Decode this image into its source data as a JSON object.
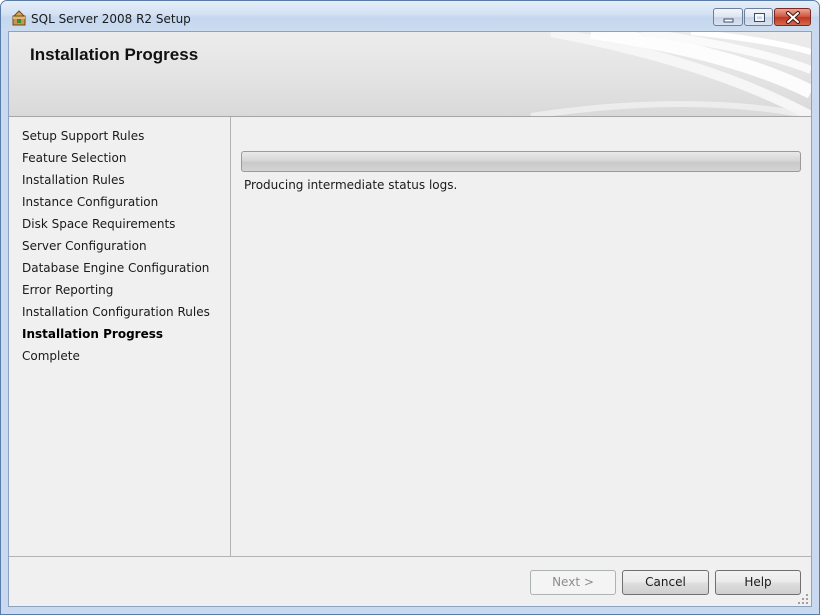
{
  "window": {
    "title": "SQL Server 2008 R2 Setup",
    "controls": {
      "minimize": "minimize-icon",
      "maximize": "maximize-icon",
      "close": "close-icon"
    }
  },
  "header": {
    "title": "Installation Progress"
  },
  "steps": [
    {
      "label": "Setup Support Rules",
      "current": false
    },
    {
      "label": "Feature Selection",
      "current": false
    },
    {
      "label": "Installation Rules",
      "current": false
    },
    {
      "label": "Instance Configuration",
      "current": false
    },
    {
      "label": "Disk Space Requirements",
      "current": false
    },
    {
      "label": "Server Configuration",
      "current": false
    },
    {
      "label": "Database Engine Configuration",
      "current": false
    },
    {
      "label": "Error Reporting",
      "current": false
    },
    {
      "label": "Installation Configuration Rules",
      "current": false
    },
    {
      "label": "Installation Progress",
      "current": true
    },
    {
      "label": "Complete",
      "current": false
    }
  ],
  "progress": {
    "value": 0,
    "status": "Producing intermediate status logs."
  },
  "buttons": {
    "next": {
      "label": "Next >",
      "enabled": false
    },
    "cancel": {
      "label": "Cancel",
      "enabled": true
    },
    "help": {
      "label": "Help",
      "enabled": true
    }
  },
  "colors": {
    "title_bar": "#d3e1f3",
    "panel_bg": "#f0f0f0",
    "close_button": "#c13520"
  }
}
